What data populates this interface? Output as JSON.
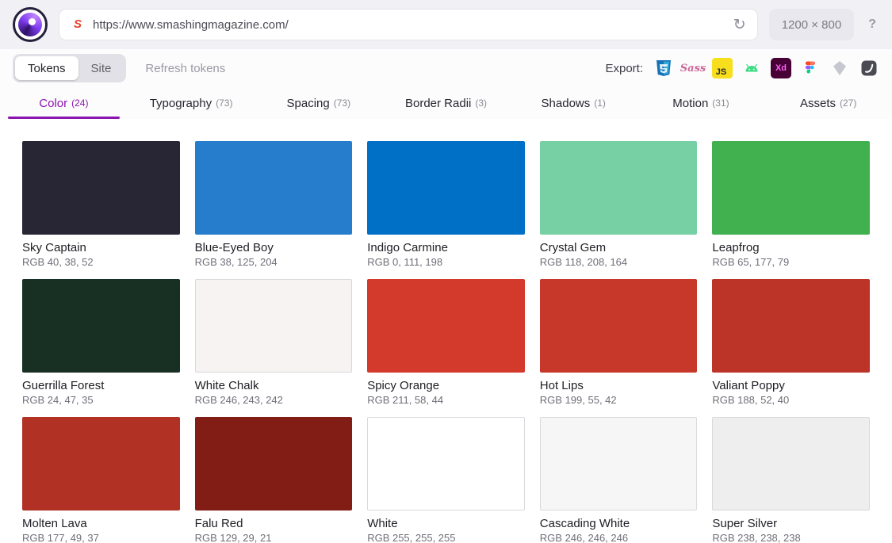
{
  "header": {
    "favicon_letter": "S",
    "url": "https://www.smashingmagazine.com/",
    "refresh_glyph": "↻",
    "viewport": "1200 × 800",
    "help": "?"
  },
  "toolbar": {
    "segments": [
      {
        "label": "Tokens",
        "active": true
      },
      {
        "label": "Site",
        "active": false
      }
    ],
    "refresh_label": "Refresh tokens"
  },
  "export": {
    "label": "Export:",
    "targets": [
      {
        "name": "css",
        "label": ""
      },
      {
        "name": "sass",
        "label": "Sass"
      },
      {
        "name": "javascript",
        "label": "JS"
      },
      {
        "name": "android",
        "label": ""
      },
      {
        "name": "adobe-xd",
        "label": "Xd"
      },
      {
        "name": "figma",
        "label": ""
      },
      {
        "name": "sketch",
        "label": ""
      },
      {
        "name": "style-dictionary",
        "label": ""
      }
    ]
  },
  "tabs": [
    {
      "label": "Color",
      "count": "(24)",
      "active": true
    },
    {
      "label": "Typography",
      "count": "(73)",
      "active": false
    },
    {
      "label": "Spacing",
      "count": "(73)",
      "active": false
    },
    {
      "label": "Border Radii",
      "count": "(3)",
      "active": false
    },
    {
      "label": "Shadows",
      "count": "(1)",
      "active": false
    },
    {
      "label": "Motion",
      "count": "(31)",
      "active": false
    },
    {
      "label": "Assets",
      "count": "(27)",
      "active": false
    }
  ],
  "colors": {
    "accent": "#8b14b1",
    "swatches": [
      {
        "name": "Sky Captain",
        "rgb": "RGB 40, 38, 52",
        "hex": "#282634",
        "bordered": false
      },
      {
        "name": "Blue-Eyed Boy",
        "rgb": "RGB 38, 125, 204",
        "hex": "#267dcc",
        "bordered": false
      },
      {
        "name": "Indigo Carmine",
        "rgb": "RGB 0, 111, 198",
        "hex": "#006fc6",
        "bordered": false
      },
      {
        "name": "Crystal Gem",
        "rgb": "RGB 118, 208, 164",
        "hex": "#76d0a4",
        "bordered": false
      },
      {
        "name": "Leapfrog",
        "rgb": "RGB 65, 177, 79",
        "hex": "#41b14f",
        "bordered": false
      },
      {
        "name": "Guerrilla Forest",
        "rgb": "RGB 24, 47, 35",
        "hex": "#182f23",
        "bordered": false
      },
      {
        "name": "White Chalk",
        "rgb": "RGB 246, 243, 242",
        "hex": "#f6f3f2",
        "bordered": true
      },
      {
        "name": "Spicy Orange",
        "rgb": "RGB 211, 58, 44",
        "hex": "#d33a2c",
        "bordered": false
      },
      {
        "name": "Hot Lips",
        "rgb": "RGB 199, 55, 42",
        "hex": "#c7372a",
        "bordered": false
      },
      {
        "name": "Valiant Poppy",
        "rgb": "RGB 188, 52, 40",
        "hex": "#bc3428",
        "bordered": false
      },
      {
        "name": "Molten Lava",
        "rgb": "RGB 177, 49, 37",
        "hex": "#b13125",
        "bordered": false
      },
      {
        "name": "Falu Red",
        "rgb": "RGB 129, 29, 21",
        "hex": "#811d15",
        "bordered": false
      },
      {
        "name": "White",
        "rgb": "RGB 255, 255, 255",
        "hex": "#ffffff",
        "bordered": true
      },
      {
        "name": "Cascading White",
        "rgb": "RGB 246, 246, 246",
        "hex": "#f6f6f6",
        "bordered": true
      },
      {
        "name": "Super Silver",
        "rgb": "RGB 238, 238, 238",
        "hex": "#eeeeee",
        "bordered": true
      }
    ]
  }
}
